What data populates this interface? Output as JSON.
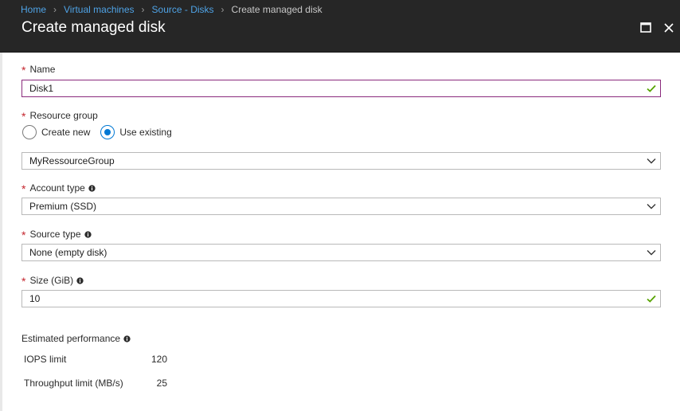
{
  "breadcrumb": {
    "items": [
      {
        "label": "Home"
      },
      {
        "label": "Virtual machines"
      },
      {
        "label": "Source - Disks"
      }
    ],
    "current": "Create managed disk"
  },
  "blade": {
    "title": "Create managed disk"
  },
  "form": {
    "name": {
      "label": "Name",
      "value": "Disk1"
    },
    "resource_group": {
      "label": "Resource group",
      "options": {
        "create_new": "Create new",
        "use_existing": "Use existing"
      },
      "selected": "use_existing",
      "value": "MyRessourceGroup"
    },
    "account_type": {
      "label": "Account type",
      "value": "Premium (SSD)"
    },
    "source_type": {
      "label": "Source type",
      "value": "None (empty disk)"
    },
    "size": {
      "label": "Size (GiB)",
      "value": "10"
    }
  },
  "performance": {
    "title": "Estimated performance",
    "rows": [
      {
        "label": "IOPS limit",
        "value": "120"
      },
      {
        "label": "Throughput limit (MB/s)",
        "value": "25"
      }
    ]
  },
  "colors": {
    "header_bg": "#262626",
    "link": "#4fa3e6",
    "required": "#c4262e",
    "valid": "#57a300",
    "focus_border": "#8a2a7c",
    "radio_accent": "#0078d4"
  }
}
